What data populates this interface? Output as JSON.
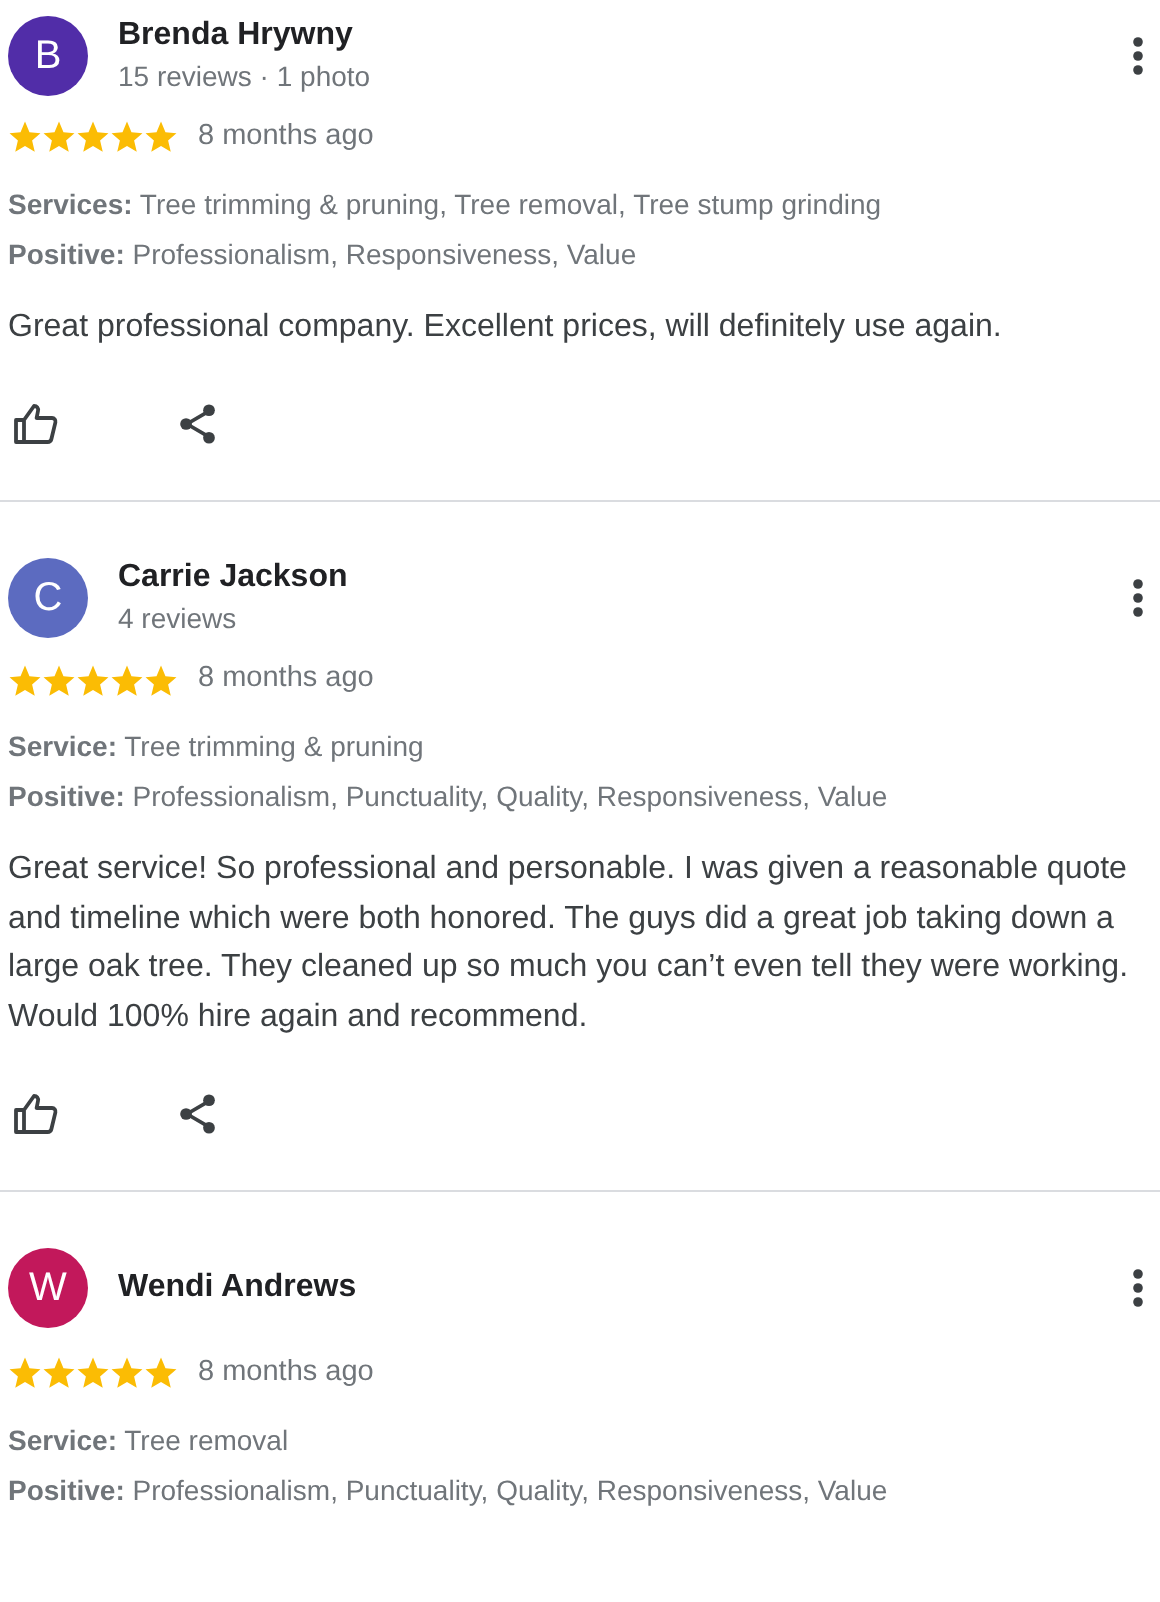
{
  "reviews": [
    {
      "initial": "B",
      "color": "#512da8",
      "name": "Brenda Hrywny",
      "meta": "15 reviews · 1 photo",
      "stars": 5,
      "time": "8 months ago",
      "details": [
        "**Services:** Tree trimming & pruning, Tree removal, Tree stump grinding",
        "**Positive:** Professionalism, Responsiveness, Value"
      ],
      "text": "Great professional company. Excellent prices, will definitely use again.",
      "actions": true
    },
    {
      "initial": "C",
      "color": "#5c6bc0",
      "name": "Carrie Jackson",
      "meta": "4 reviews",
      "stars": 5,
      "time": "8 months ago",
      "details": [
        "**Service:** Tree trimming & pruning",
        "**Positive:** Professionalism, Punctuality, Quality, Responsiveness, Value"
      ],
      "text": "Great service! So professional and personable. I was given a reasonable quote and timeline which were both honored. The guys did a great job taking down a large oak tree. They cleaned up so much you can’t even tell they were working. Would 100% hire again and recommend.",
      "actions": true
    },
    {
      "initial": "W",
      "color": "#c2185b",
      "name": "Wendi Andrews",
      "stars": 5,
      "time": "8 months ago",
      "details": [
        "**Service:** Tree removal",
        "**Positive:** Professionalism, Punctuality, Quality, Responsiveness, Value"
      ]
    }
  ]
}
